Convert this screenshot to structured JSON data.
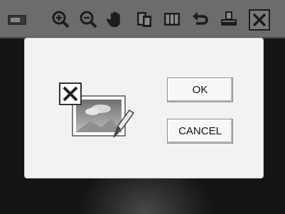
{
  "toolbar": {
    "icons": [
      "media-icon",
      "zoom-in-icon",
      "zoom-out-icon",
      "pan-hand-icon",
      "copy-icon",
      "tile-view-icon",
      "rotate-icon",
      "print-icon",
      "close-icon"
    ]
  },
  "dialog": {
    "ok_label": "OK",
    "cancel_label": "CANCEL",
    "illustration_icon": "delete-image-icon"
  },
  "colors": {
    "toolbar_bg": "#6c6c6c",
    "dialog_bg": "#f2f2f2",
    "icon_dark": "#1c1c1c"
  }
}
